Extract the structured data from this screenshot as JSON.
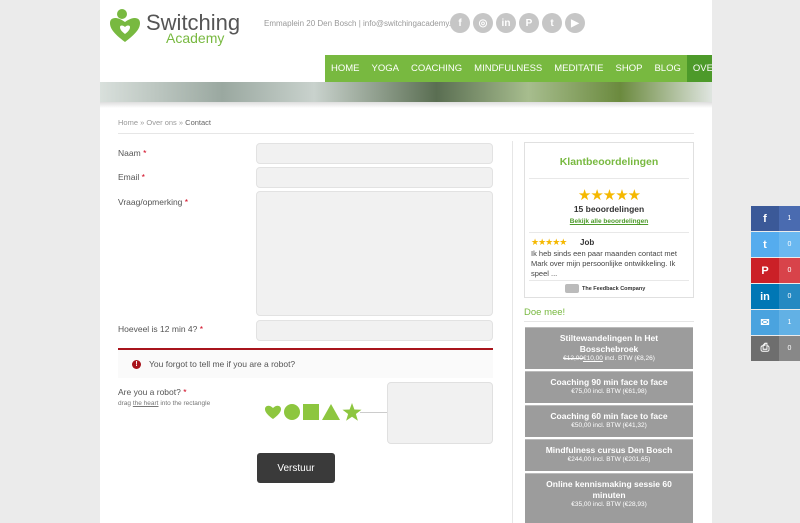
{
  "header": {
    "logo_word1": "Switching",
    "logo_word2": "Academy",
    "address": "Emmaplein 20 Den Bosch | info@switchingacademy.nl",
    "socials": [
      {
        "icon": "facebook-icon",
        "glyph": "f"
      },
      {
        "icon": "instagram-icon",
        "glyph": "◎"
      },
      {
        "icon": "linkedin-icon",
        "glyph": "in"
      },
      {
        "icon": "pinterest-icon",
        "glyph": "P"
      },
      {
        "icon": "twitter-icon",
        "glyph": "t"
      },
      {
        "icon": "youtube-icon",
        "glyph": "▶"
      }
    ]
  },
  "nav": [
    "HOME",
    "YOGA",
    "COACHING",
    "MINDFULNESS",
    "MEDITATIE",
    "SHOP",
    "BLOG",
    "OVER ONS"
  ],
  "nav_active": "OVER ONS",
  "breadcrumb": {
    "home": "Home",
    "sep": "»",
    "parent": "Over ons",
    "current": "Contact"
  },
  "form": {
    "name_label": "Naam",
    "email_label": "Email",
    "message_label": "Vraag/opmerking",
    "captcha_label": "Hoeveel is 12 min 4?",
    "required": "*",
    "error": "You forgot to tell me if you are a robot?",
    "robot_label": "Are you a robot?",
    "robot_hint_1": "drag",
    "robot_hint_link": "the heart",
    "robot_hint_2": "into the rectangle",
    "submit": "Verstuur"
  },
  "reviews": {
    "title": "Klantbeoordelingen",
    "stars": "★★★★★",
    "count": "15 beoordelingen",
    "all_link": "Bekijk alle beoordelingen",
    "review_stars": "★★★★★",
    "reviewer": "Job",
    "text": "Ik heb sinds een paar maanden contact met Mark over mijn persoonlijke ontwikkeling. Ik speel ...",
    "provider": "The Feedback Company"
  },
  "doe_mee": "Doe mee!",
  "products": [
    {
      "name": "Stiltewandelingen In Het Bosschebroek",
      "old": "€12,00",
      "price": "€10,00",
      "suffix": "incl. BTW (€8,26)"
    },
    {
      "name": "Coaching 90 min face to face",
      "old": "",
      "price": "€75,00",
      "suffix": "incl. BTW (€61,98)"
    },
    {
      "name": "Coaching 60 min face to face",
      "old": "",
      "price": "€50,00",
      "suffix": "incl. BTW (€41,32)"
    },
    {
      "name": "Mindfulness cursus Den Bosch",
      "old": "",
      "price": "€244,00",
      "suffix": "incl. BTW (€201,65)"
    },
    {
      "name": "Online kennismaking sessie 60 minuten",
      "old": "",
      "price": "€35,00",
      "suffix": "incl. BTW (€28,93)"
    }
  ],
  "share": [
    {
      "icon": "facebook-icon",
      "glyph": "f",
      "count": "1",
      "color": "#3b5998",
      "dark": "#4a6bb0"
    },
    {
      "icon": "twitter-icon",
      "glyph": "t",
      "count": "0",
      "color": "#55acee",
      "dark": "#6ab8f0"
    },
    {
      "icon": "pinterest-icon",
      "glyph": "P",
      "count": "0",
      "color": "#cb2027",
      "dark": "#d8434a"
    },
    {
      "icon": "linkedin-icon",
      "glyph": "in",
      "count": "0",
      "color": "#0077b5",
      "dark": "#2589c2"
    },
    {
      "icon": "email-icon",
      "glyph": "✉",
      "count": "1",
      "color": "#4aa3df",
      "dark": "#62b1e5"
    },
    {
      "icon": "print-icon",
      "glyph": "⎙",
      "count": "0",
      "color": "#6e6e6e",
      "dark": "#888888"
    }
  ],
  "colors": {
    "brand_green": "#78b940",
    "nav_active": "#4d9a2a",
    "error": "#a8141c",
    "star": "#f5b800"
  }
}
